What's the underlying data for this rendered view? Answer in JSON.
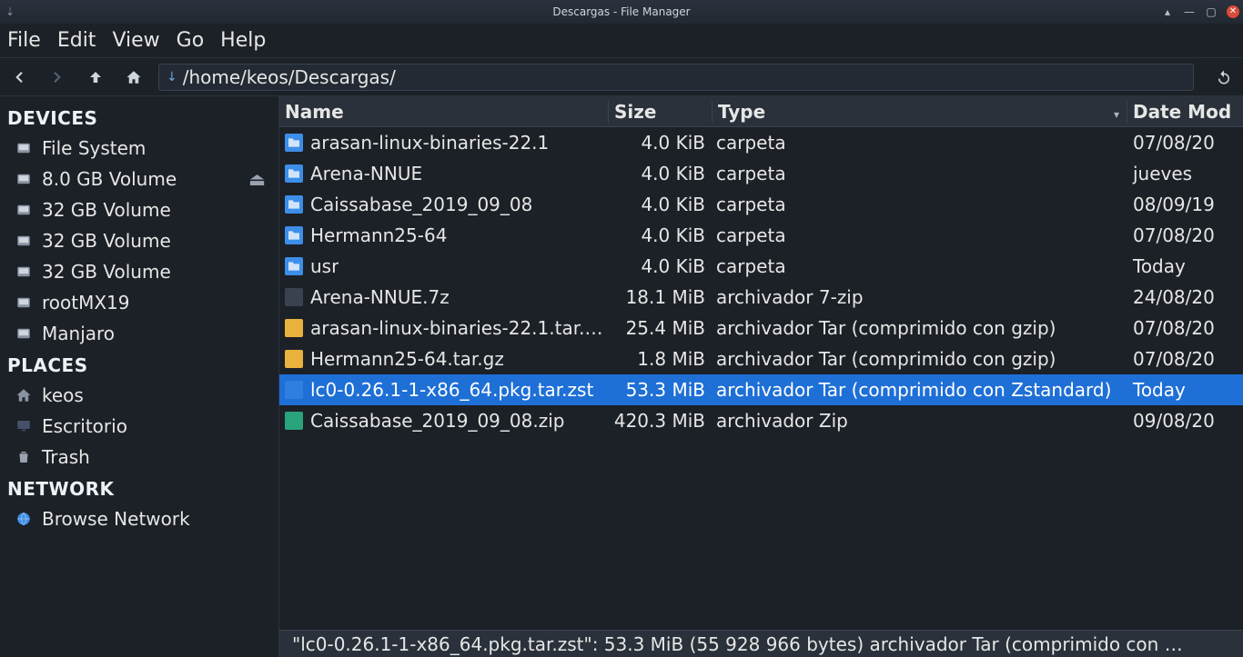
{
  "window": {
    "title": "Descargas - File Manager"
  },
  "menubar": {
    "file": "File",
    "edit": "Edit",
    "view": "View",
    "go": "Go",
    "help": "Help"
  },
  "toolbar": {
    "path": "/home/keos/Descargas/"
  },
  "sidebar": {
    "devices_header": "DEVICES",
    "places_header": "PLACES",
    "network_header": "NETWORK",
    "devices": [
      {
        "label": "File System",
        "icon": "drive"
      },
      {
        "label": "8.0 GB Volume",
        "icon": "drive",
        "ejectable": true
      },
      {
        "label": "32 GB Volume",
        "icon": "drive"
      },
      {
        "label": "32 GB Volume",
        "icon": "drive"
      },
      {
        "label": "32 GB Volume",
        "icon": "drive"
      },
      {
        "label": "rootMX19",
        "icon": "drive"
      },
      {
        "label": "Manjaro",
        "icon": "drive"
      }
    ],
    "places": [
      {
        "label": "keos",
        "icon": "home"
      },
      {
        "label": "Escritorio",
        "icon": "desktop"
      },
      {
        "label": "Trash",
        "icon": "trash"
      }
    ],
    "network": [
      {
        "label": "Browse Network",
        "icon": "globe"
      }
    ]
  },
  "columns": {
    "name": "Name",
    "size": "Size",
    "type": "Type",
    "date": "Date Mod"
  },
  "files": [
    {
      "name": "arasan-linux-binaries-22.1",
      "size": "4.0 KiB",
      "type": "carpeta",
      "date": "07/08/20",
      "kind": "folder"
    },
    {
      "name": "Arena-NNUE",
      "size": "4.0 KiB",
      "type": "carpeta",
      "date": "jueves",
      "kind": "folder"
    },
    {
      "name": "Caissabase_2019_09_08",
      "size": "4.0 KiB",
      "type": "carpeta",
      "date": "08/09/19",
      "kind": "folder"
    },
    {
      "name": "Hermann25-64",
      "size": "4.0 KiB",
      "type": "carpeta",
      "date": "07/08/20",
      "kind": "folder"
    },
    {
      "name": "usr",
      "size": "4.0 KiB",
      "type": "carpeta",
      "date": "Today",
      "kind": "folder"
    },
    {
      "name": "Arena-NNUE.7z",
      "size": "18.1 MiB",
      "type": "archivador 7-zip",
      "date": "24/08/20",
      "kind": "7z"
    },
    {
      "name": "arasan-linux-binaries-22.1.tar.…",
      "size": "25.4 MiB",
      "type": "archivador Tar (comprimido con gzip)",
      "date": "07/08/20",
      "kind": "gz"
    },
    {
      "name": "Hermann25-64.tar.gz",
      "size": "1.8 MiB",
      "type": "archivador Tar (comprimido con gzip)",
      "date": "07/08/20",
      "kind": "gz"
    },
    {
      "name": "lc0-0.26.1-1-x86_64.pkg.tar.zst",
      "size": "53.3 MiB",
      "type": "archivador Tar (comprimido con Zstandard)",
      "date": "Today",
      "kind": "zst",
      "selected": true
    },
    {
      "name": "Caissabase_2019_09_08.zip",
      "size": "420.3 MiB",
      "type": "archivador Zip",
      "date": "09/08/20",
      "kind": "zip"
    }
  ],
  "statusbar": "\"lc0-0.26.1-1-x86_64.pkg.tar.zst\": 53.3 MiB (55 928 966 bytes) archivador Tar (comprimido con …"
}
